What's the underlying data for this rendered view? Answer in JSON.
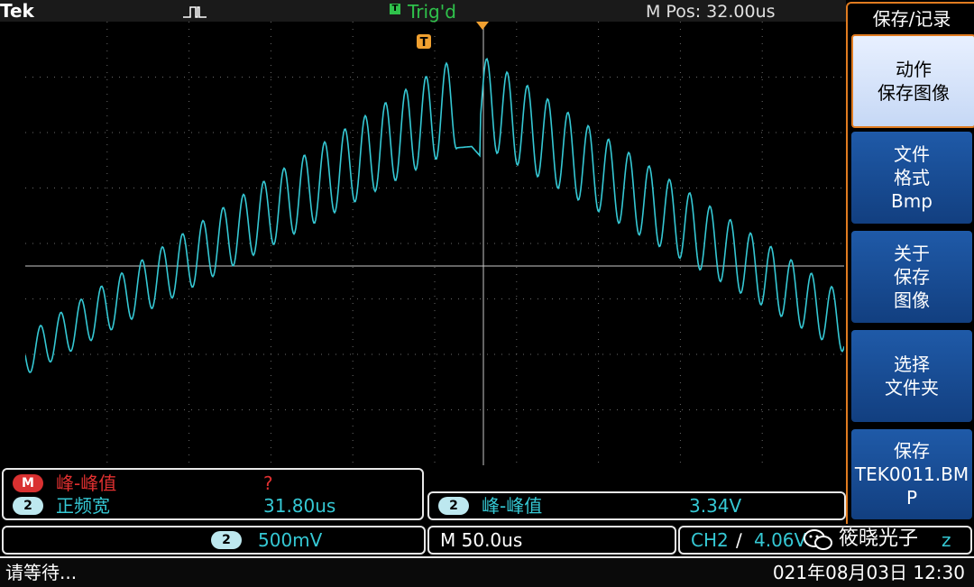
{
  "brand": "Tek",
  "acquisition": {
    "icon": "single-pulse-icon"
  },
  "trigger": {
    "box": "T",
    "state": "Trig'd"
  },
  "horizontal_position": "M Pos: 32.00us",
  "menu": {
    "title": "保存/记录",
    "buttons": [
      {
        "lines": [
          "动作",
          "保存图像"
        ]
      },
      {
        "lines": [
          "文件",
          "格式",
          "Bmp"
        ]
      },
      {
        "lines": [
          "关于",
          "保存",
          "图像"
        ]
      },
      {
        "lines": [
          "选择",
          "文件夹"
        ]
      },
      {
        "lines": [
          "保存",
          "TEK0011.BM",
          "P"
        ]
      }
    ]
  },
  "measurements_left": [
    {
      "badge": "M",
      "label": "峰-峰值",
      "value": "?"
    },
    {
      "badge": "2",
      "label": "正频宽",
      "value": "31.80us"
    }
  ],
  "measurement_right": {
    "badge": "2",
    "label": "峰-峰值",
    "value": "3.34V"
  },
  "channel": {
    "badge": "2",
    "scale": "500mV"
  },
  "timebase": "M 50.0us",
  "trigger_readout": {
    "channel": "CH2",
    "slope": "∕",
    "level": "4.06V",
    "extra": "z"
  },
  "status": "请等待...",
  "datetime": "021年08月03日 12:30",
  "watermark": "筱晓光子",
  "colors": {
    "trace": "#35c8d4",
    "trigger": "#2fc24b",
    "accent": "#e07b20",
    "marker": "#f0a030"
  }
}
